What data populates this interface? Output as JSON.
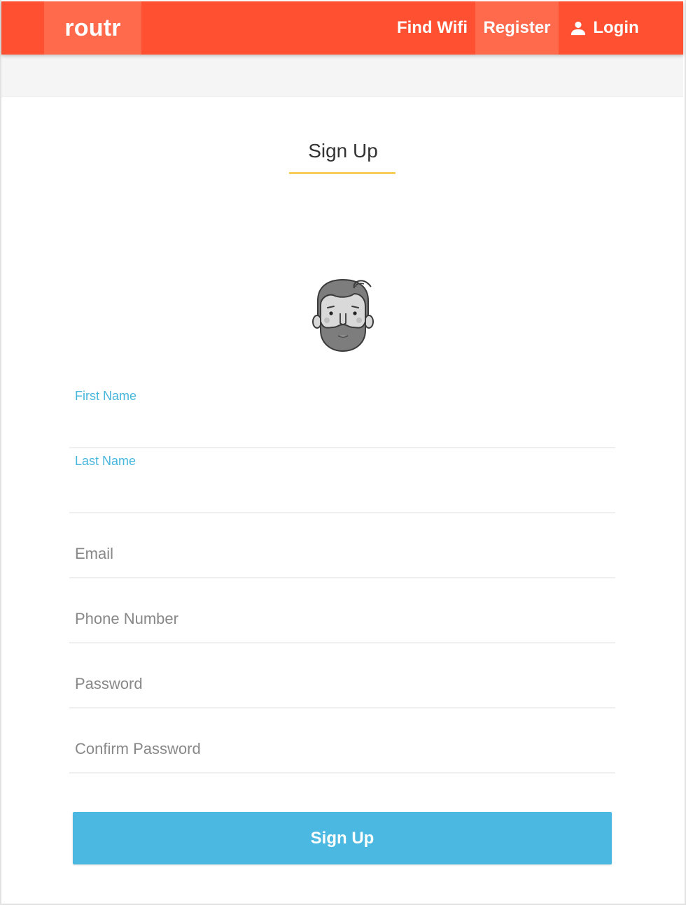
{
  "nav": {
    "brand": "routr",
    "items": [
      {
        "label": "Find Wifi"
      },
      {
        "label": "Register"
      },
      {
        "label": "Login",
        "icon": "user-icon"
      }
    ],
    "colors": {
      "bar": "#ff5131",
      "active": "#ff6a4d"
    }
  },
  "page": {
    "title": "Sign Up",
    "title_accent": "#f7ce5b"
  },
  "form": {
    "first_name": {
      "label": "First Name",
      "value": ""
    },
    "last_name": {
      "label": "Last Name",
      "value": ""
    },
    "email": {
      "placeholder": "Email"
    },
    "phone": {
      "placeholder": "Phone Number"
    },
    "password": {
      "placeholder": "Password"
    },
    "confirm_password": {
      "placeholder": "Confirm Password"
    },
    "submit_label": "Sign Up",
    "accent": "#46b6dd"
  },
  "avatar": {
    "icon": "bearded-man-avatar-icon"
  }
}
